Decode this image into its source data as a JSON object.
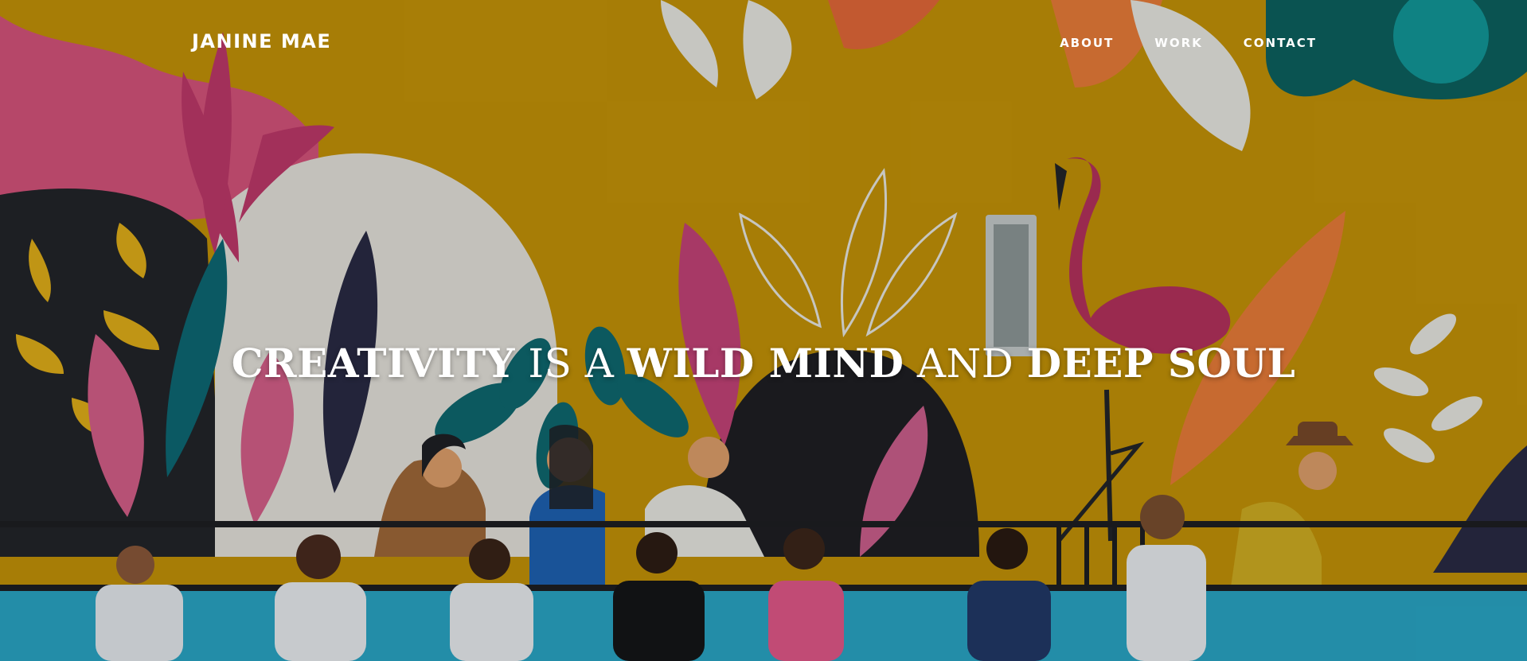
{
  "site": {
    "brand": "JANINE MAE"
  },
  "nav": {
    "items": [
      {
        "label": "ABOUT"
      },
      {
        "label": "WORK"
      },
      {
        "label": "CONTACT"
      }
    ]
  },
  "hero": {
    "headline": [
      {
        "text": "CREATIVITY",
        "style": "bold"
      },
      {
        "text": " IS A ",
        "style": "regular"
      },
      {
        "text": "WILD MIND",
        "style": "bold"
      },
      {
        "text": " AND ",
        "style": "regular"
      },
      {
        "text": "DEEP SOUL",
        "style": "bold"
      }
    ],
    "background_image": "painted mural with tropical leaves, a flamingo, figures and people in masks waving"
  },
  "colors": {
    "mural_yellow": "#c89608",
    "mural_pink": "#c03a6a",
    "mural_teal": "#0d6b6e",
    "mural_dark": "#1e1f23",
    "wall_blue": "#2aa9c9",
    "text": "#ffffff"
  }
}
